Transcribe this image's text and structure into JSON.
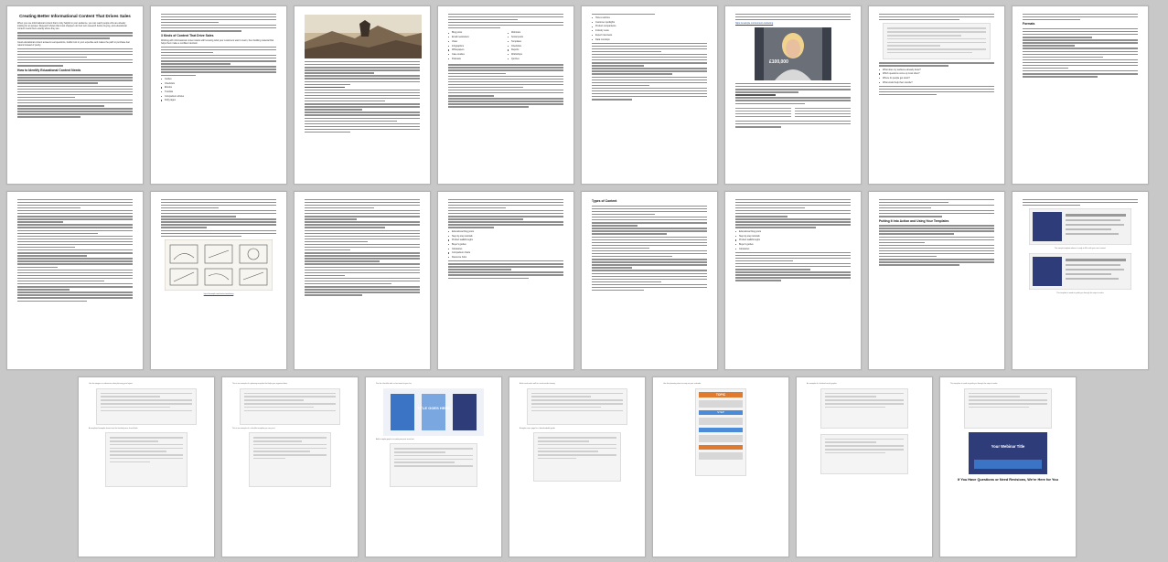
{
  "document": {
    "title": "Creating Better Informational Content That Drives Sales",
    "headings": {
      "identify_people": "How to Identify Educational Content Needs",
      "kinds": "3 Kinds of Content That Drive Sales",
      "types": "Types of Content",
      "putting": "Putting It Into Action and Using Your Templates",
      "formats": "Formats",
      "closing": "If You Have Questions or Need Revisions, We're Here for You"
    },
    "page1": {
      "intro": "When you use informational content that is truly helpful to your audience, you can reach people who are already looking for an answer. Research shows that most shoppers do their own research before buying, and educational content meets them exactly where they are.",
      "sub": "Good educational content answers real questions, builds trust in your expertise and makes the path to purchase feel natural instead of pushy."
    },
    "page2": {
      "lead": "Working with informational content starts with knowing what your customers want to learn, then building material that helps them make a confident decision.",
      "list": [
        "Guides",
        "Checklists",
        "Ebooks",
        "Tutorials",
        "Comparison articles",
        "FAQ pages"
      ]
    },
    "page4": {
      "list_a": [
        "Blog posts",
        "Email newsletters",
        "Video",
        "Infographics",
        "Whitepapers",
        "Case studies",
        "Podcasts"
      ],
      "list_b": [
        "Webinars",
        "Social posts",
        "Templates",
        "Checklists",
        "Reports",
        "Workshops",
        "Quizzes"
      ]
    },
    "page5": {
      "list": [
        "How-to articles",
        "Customer spotlights",
        "Product comparisons",
        "Industry news",
        "Expert interviews",
        "Data roundups"
      ]
    },
    "page6": {
      "link": "https://example.com/content-marketing"
    },
    "page7": {
      "questions": [
        "What does my audience already know?",
        "Which questions come up most often?",
        "Where do people get stuck?",
        "What would help them decide?"
      ]
    },
    "page12": {
      "list": [
        "Educational blog posts",
        "Step-by-step tutorials",
        "Product walkthroughs",
        "Buyer's guides",
        "Glossaries",
        "Comparison charts",
        "Resource hubs"
      ]
    },
    "page14": {
      "list": [
        "Educational blog posts",
        "Step-by-step tutorials",
        "Product walkthroughs",
        "Buyer's guides",
        "Glossaries"
      ]
    },
    "captions": {
      "c1": "The sample template above is ready to fill in with your own content.",
      "c2": "This template is made to guide you through the steps in order.",
      "c3": "Use the images as references when planning your layout.",
      "c4": "A completed example shows how the finished piece should look.",
      "c5": "This is an example of a planning template that helps you organize ideas.",
      "c6": "This is an example of a checklist template you can print.",
      "c7": "Pair the checklist with a short email to your list.",
      "c8": "Add a simple graphic to make your post stand out.",
      "c9": "A title card works well for social media sharing.",
      "c10": "A simple cover page for a downloadable guide.",
      "c11": "Use this planning sheet to map out your calendar.",
      "c12": "An example of a finished social graphic."
    },
    "graphics": {
      "book_title": "TITLE GOES HERE",
      "price_badge": "£100,000",
      "webinar_cover": "Your Webinar Title",
      "infographic_top": "TOPIC",
      "infographic_row": "STEP"
    },
    "colors": {
      "page": "#ffffff",
      "background": "#c8c8c8",
      "text_bar": "#8e8e8e",
      "link": "#1f4fb3",
      "cover_navy": "#2e3c7a",
      "book_blue": "#3b74c4"
    }
  }
}
